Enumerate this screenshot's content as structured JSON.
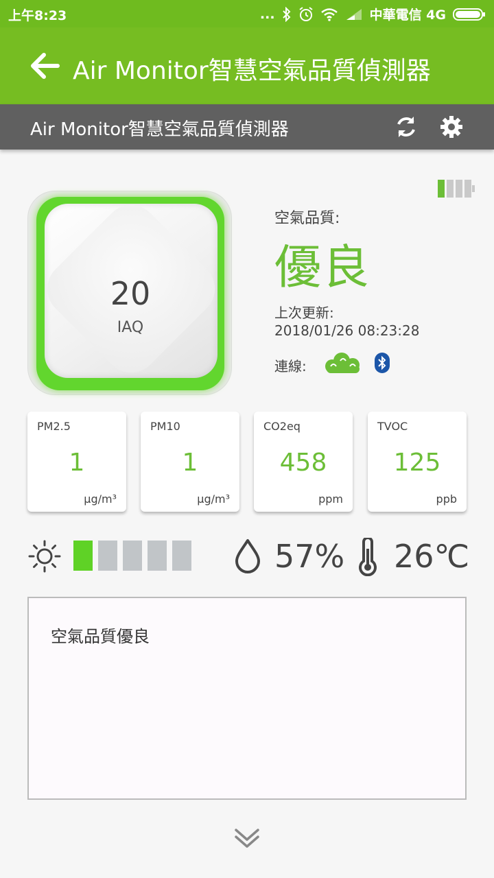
{
  "status_bar": {
    "time": "上午8:23",
    "dots": "...",
    "carrier": "中華電信 4G"
  },
  "app_bar": {
    "title": "Air Monitor智慧空氣品質偵測器",
    "back_icon": "arrow-left-icon"
  },
  "sub_bar": {
    "title": "Air Monitor智慧空氣品質偵測器",
    "refresh_icon": "refresh-icon",
    "settings_icon": "gear-icon"
  },
  "device": {
    "iaq_value": "20",
    "iaq_label": "IAQ",
    "glow_color": "#62d62e"
  },
  "air_quality": {
    "label": "空氣品質:",
    "value": "優良",
    "updated_label": "上次更新:",
    "updated_value": "2018/01/26 08:23:28",
    "connection_label": "連線:"
  },
  "battery_level": "1/3",
  "metrics": [
    {
      "name": "PM2.5",
      "value": "1",
      "unit": "μg/m³"
    },
    {
      "name": "PM10",
      "value": "1",
      "unit": "μg/m³"
    },
    {
      "name": "CO2eq",
      "value": "458",
      "unit": "ppm"
    },
    {
      "name": "TVOC",
      "value": "125",
      "unit": "ppb"
    }
  ],
  "light_level": {
    "active_segments": 1,
    "total_segments": 5
  },
  "humidity": "57%",
  "temperature": "26℃",
  "message": "空氣品質優良",
  "colors": {
    "accent_green": "#76bd22",
    "value_green": "#6cbe37",
    "subbar_gray": "#606060"
  }
}
